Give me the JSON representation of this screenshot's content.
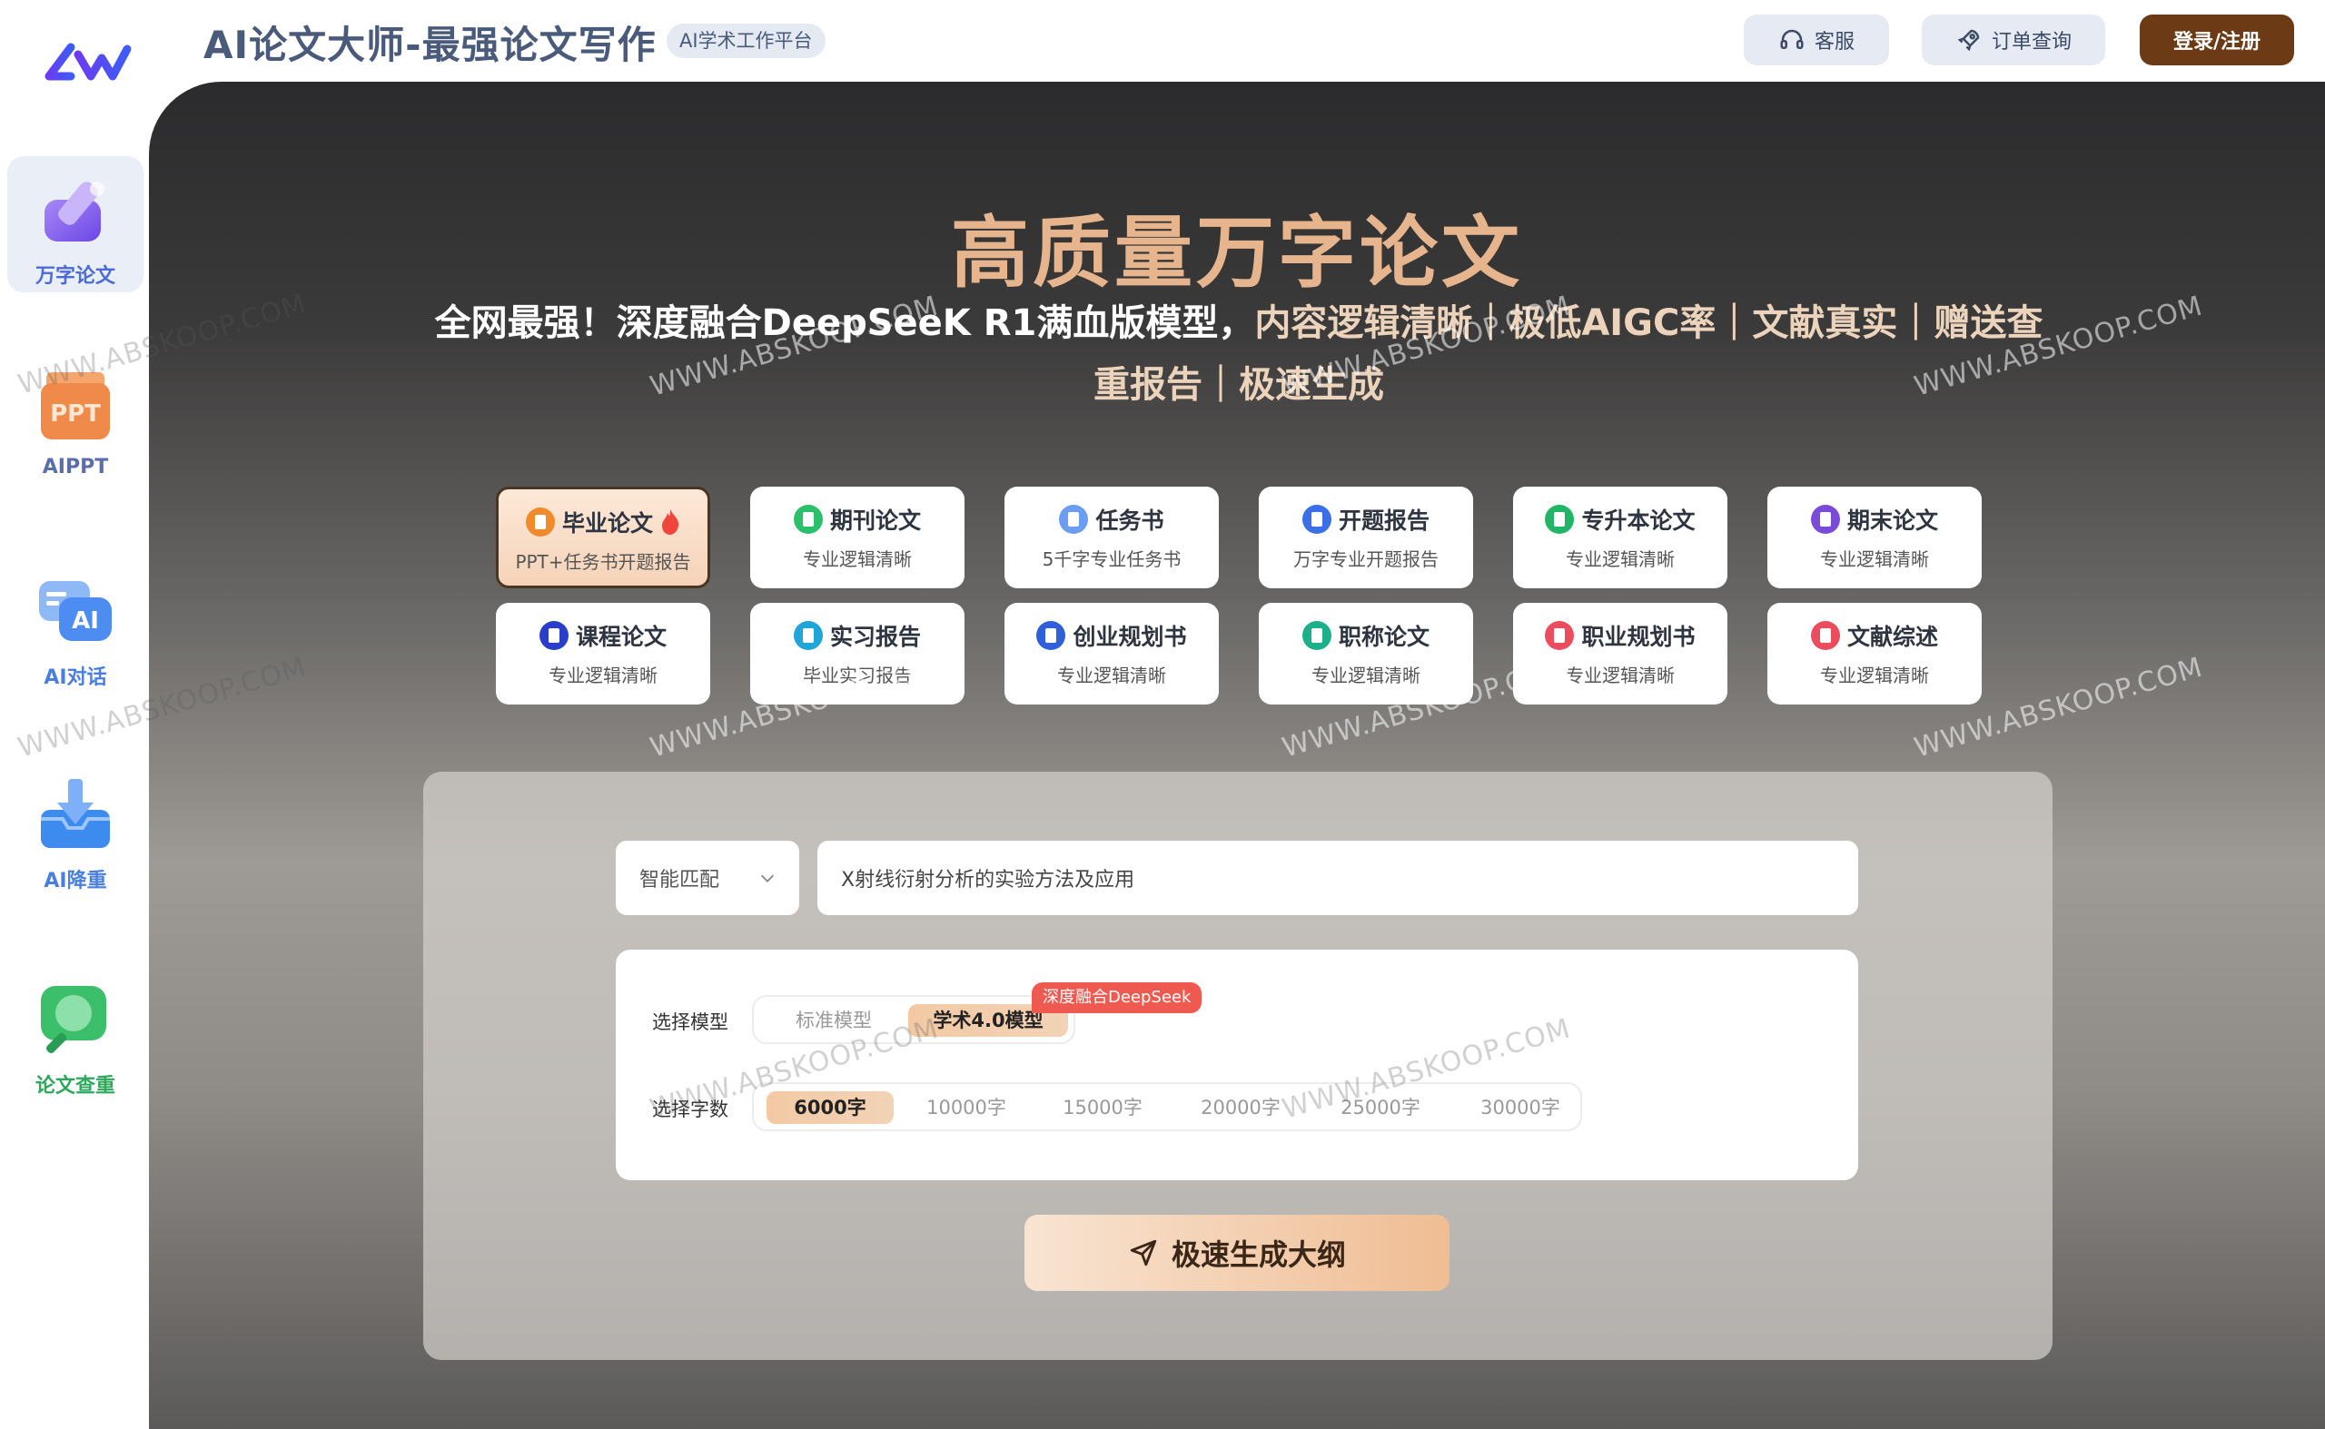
{
  "header": {
    "app_title": "AI论文大师-最强论文写作",
    "badge": "AI学术工作平台",
    "service_label": "客服",
    "order_label": "订单查询",
    "login_label": "登录/注册"
  },
  "sidebar": {
    "items": [
      {
        "label": "万字论文",
        "icon": "pen-icon",
        "active": true
      },
      {
        "label": "AIPPT",
        "icon": "ppt-icon"
      },
      {
        "label": "AI对话",
        "icon": "chat-ai-icon"
      },
      {
        "label": "AI降重",
        "icon": "download-tray-icon"
      },
      {
        "label": "论文查重",
        "icon": "magnifier-icon"
      }
    ]
  },
  "hero": {
    "title": "高质量万字论文",
    "sub_lead": "全网最强！深度融合DeepSeeK R1满血版模型，",
    "sub_rest": "内容逻辑清晰｜极低AIGC率｜文献真实｜赠送查重报告｜极速生成"
  },
  "categories": [
    {
      "title": "毕业论文",
      "sub": "PPT+任务书开题报告",
      "color": "#f08a2a",
      "active": true,
      "hot": true
    },
    {
      "title": "期刊论文",
      "sub": "专业逻辑清晰",
      "color": "#2cbf6c"
    },
    {
      "title": "任务书",
      "sub": "5千字专业任务书",
      "color": "#6b9df2"
    },
    {
      "title": "开题报告",
      "sub": "万字专业开题报告",
      "color": "#3a6fe8"
    },
    {
      "title": "专升本论文",
      "sub": "专业逻辑清晰",
      "color": "#23b567"
    },
    {
      "title": "期末论文",
      "sub": "专业逻辑清晰",
      "color": "#7a4bd8"
    },
    {
      "title": "课程论文",
      "sub": "专业逻辑清晰",
      "color": "#2a3fc9"
    },
    {
      "title": "实习报告",
      "sub": "毕业实习报告",
      "color": "#1fa5d6"
    },
    {
      "title": "创业规划书",
      "sub": "专业逻辑清晰",
      "color": "#2f60d9"
    },
    {
      "title": "职称论文",
      "sub": "专业逻辑清晰",
      "color": "#1cb08a"
    },
    {
      "title": "职业规划书",
      "sub": "专业逻辑清晰",
      "color": "#ea4d5e"
    },
    {
      "title": "文献综述",
      "sub": "专业逻辑清晰",
      "color": "#ea4d5e"
    }
  ],
  "form": {
    "mode_select": "智能匹配",
    "topic_value": "X射线衍射分析的实验方法及应用",
    "model_label": "选择模型",
    "models": [
      "标准模型",
      "学术4.0模型"
    ],
    "selected_model": "学术4.0模型",
    "deepseek_badge": "深度融合DeepSeek",
    "words_label": "选择字数",
    "word_options": [
      "6000字",
      "10000字",
      "15000字",
      "20000字",
      "25000字",
      "30000字"
    ],
    "selected_words": "6000字",
    "generate_label": "极速生成大纲"
  },
  "watermark": "WWW.ABSKOOP.COM",
  "colors": {
    "hero_title": "#e7b58d",
    "login_bg": "#6d3a16",
    "active_border": "#4a3522",
    "deepseek_badge": "#ee5a4f"
  }
}
